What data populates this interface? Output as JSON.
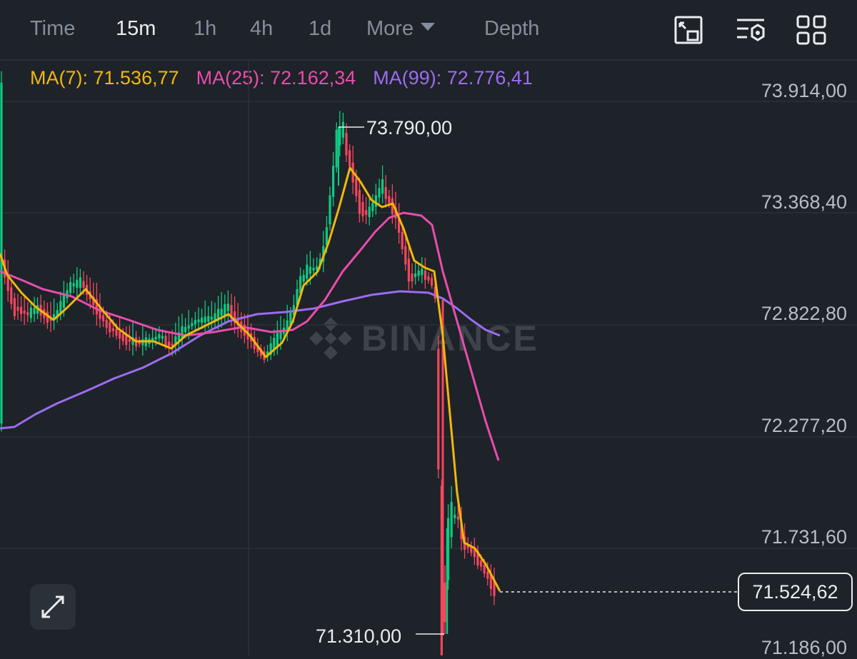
{
  "timeframes": {
    "time": "Time",
    "m15": "15m",
    "h1": "1h",
    "h4": "4h",
    "d1": "1d",
    "more": "More",
    "depth": "Depth"
  },
  "toolbar_icons": [
    "fullscreen-toggle-icon",
    "indicator-settings-icon",
    "grid-layout-icon"
  ],
  "moving_averages": {
    "ma7": "MA(7): 71.536,77",
    "ma25": "MA(25): 72.162,34",
    "ma99": "MA(99): 72.776,41"
  },
  "price_axis": {
    "p1": "73.914,00",
    "p2": "73.368,40",
    "p3": "72.822,80",
    "p4": "72.277,20",
    "p5": "71.731,60",
    "p6": "71.186,00"
  },
  "last_price": "71.524,62",
  "high_label": "73.790,00",
  "low_label": "71.310,00",
  "watermark": "BINANCE",
  "colors": {
    "ma7": "#f0b90b",
    "ma25": "#e84dab",
    "ma99": "#9c6cf0",
    "up": "#0ecb81",
    "down": "#f6465d",
    "background": "#1e2229",
    "grid": "#2b3139"
  }
}
